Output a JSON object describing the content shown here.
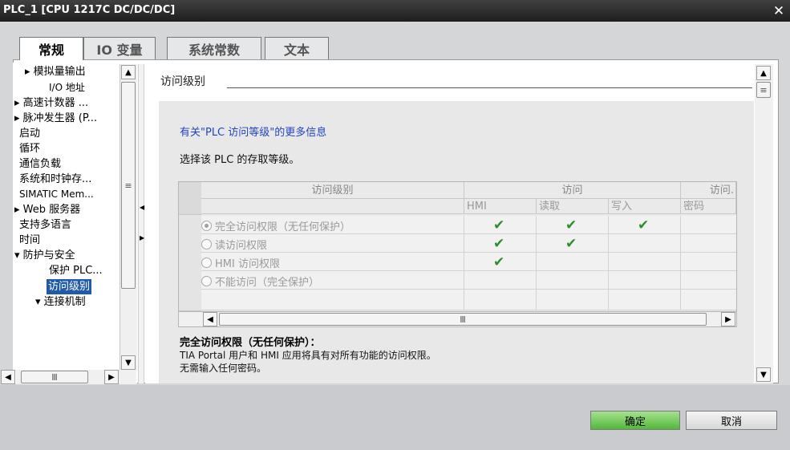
{
  "window": {
    "title": "PLC_1 [CPU 1217C DC/DC/DC]",
    "close_glyph": "✕"
  },
  "tabs": [
    {
      "label": "常规"
    },
    {
      "label": "IO 变量"
    },
    {
      "label": "系统常数"
    },
    {
      "label": "文本"
    }
  ],
  "nav": {
    "items": [
      {
        "label": "▸ 模拟量输出"
      },
      {
        "label": "I/O 地址"
      },
      {
        "label": "▸ 高速计数器 ..."
      },
      {
        "label": "▸ 脉冲发生器 (P..."
      },
      {
        "label": "启动"
      },
      {
        "label": "循环"
      },
      {
        "label": "通信负载"
      },
      {
        "label": "系统和时钟存..."
      },
      {
        "label": "SIMATIC Mem..."
      },
      {
        "label": "▸ Web 服务器"
      },
      {
        "label": "支持多语言"
      },
      {
        "label": "时间"
      },
      {
        "label": "▾ 防护与安全"
      },
      {
        "label": "保护 PLC..."
      },
      {
        "label": "访问级别"
      },
      {
        "label": "▾ 连接机制"
      }
    ]
  },
  "section": {
    "title": "访问级别",
    "info_link": "有关\"PLC 访问等级\"的更多信息",
    "select_label": "选择该 PLC 的存取等级。"
  },
  "table": {
    "headers": {
      "level": "访问级别",
      "access": "访问",
      "access_pw": "访问."
    },
    "subheaders": [
      "HMI",
      "读取",
      "写入",
      "密码"
    ],
    "rows": [
      {
        "label": "完全访问权限（无任何保护）",
        "selected": true,
        "hmi": "✔",
        "read": "✔",
        "write": "✔"
      },
      {
        "label": "读访问权限",
        "selected": false,
        "hmi": "✔",
        "read": "✔",
        "write": ""
      },
      {
        "label": "HMI 访问权限",
        "selected": false,
        "hmi": "✔",
        "read": "",
        "write": ""
      },
      {
        "label": "不能访问（完全保护）",
        "selected": false,
        "hmi": "",
        "read": "",
        "write": ""
      }
    ]
  },
  "description": {
    "title": "完全访问权限（无任何保护）：",
    "line1": "TIA Portal 用户和 HMI 应用将具有对所有功能的访问权限。",
    "line2": "无需输入任何密码。"
  },
  "buttons": {
    "ok": "确定",
    "cancel": "取消"
  },
  "scroll_glyphs": {
    "up": "▲",
    "down": "▼",
    "left": "◀",
    "right": "▶",
    "grip": "Ⅲ",
    "grip_h": "≡"
  },
  "colors": {
    "selected": "#1f5ba8",
    "link": "#2045c8",
    "check": "#2c8f2c",
    "ok_button": "#6cc653"
  }
}
